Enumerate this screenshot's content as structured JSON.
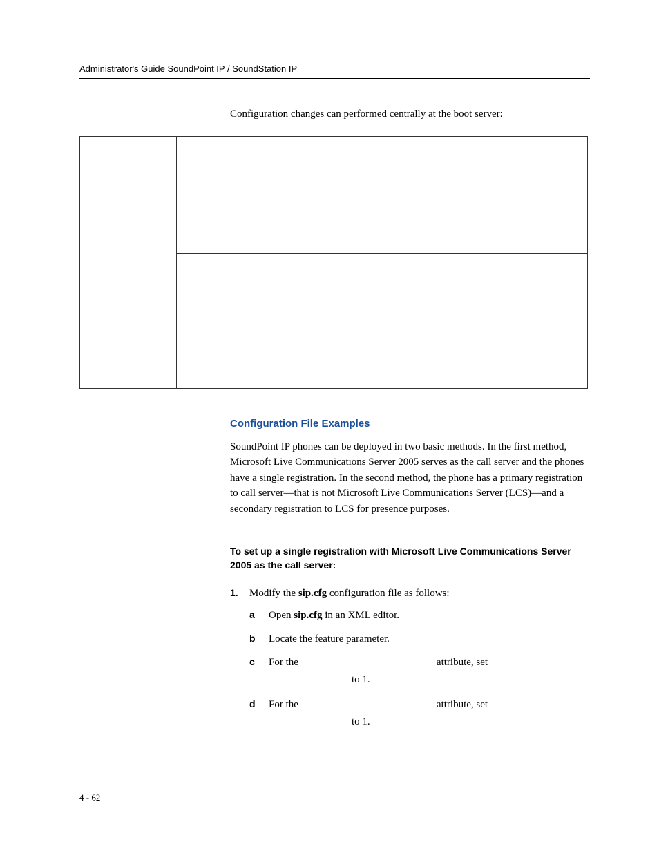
{
  "header": {
    "running_head": "Administrator's Guide SoundPoint IP / SoundStation IP"
  },
  "lead": "Configuration changes can performed centrally at the boot server:",
  "section": {
    "heading": "Configuration File Examples",
    "body": "SoundPoint IP phones can be deployed in two basic methods. In the first method, Microsoft Live Communications Server 2005 serves as the call server and the phones have a single registration. In the second method, the phone has a primary registration to call server—that is not Microsoft Live Communications Server (LCS)—and a secondary registration to LCS for presence purposes."
  },
  "task": {
    "heading": "To set up a single registration with Microsoft Live Communications Server 2005 as the call server:",
    "step1": {
      "num": "1.",
      "text_pre": "Modify the ",
      "text_bold": "sip.cfg",
      "text_post": " configuration file as follows:",
      "a": {
        "letter": "a",
        "pre": "Open ",
        "bold": "sip.cfg",
        "post": " in an XML editor."
      },
      "b": {
        "letter": "b",
        "text": "Locate the feature parameter."
      },
      "c": {
        "letter": "c",
        "pre": "For the",
        "post": "attribute, set",
        "to": "to 1."
      },
      "d": {
        "letter": "d",
        "pre": "For the",
        "post": "attribute, set",
        "to": "to 1."
      }
    }
  },
  "footer": {
    "page_number": "4 - 62"
  }
}
